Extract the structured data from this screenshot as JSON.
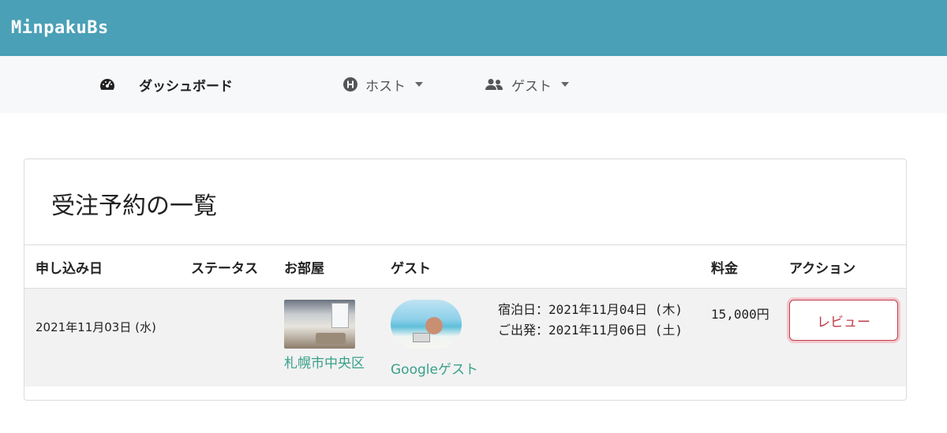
{
  "app": {
    "brand": "MinpakuBs"
  },
  "nav": {
    "dashboard": {
      "label": "ダッシュボード",
      "icon": "gauge-icon"
    },
    "host": {
      "label": "ホスト",
      "icon": "h-circle-icon"
    },
    "guest": {
      "label": "ゲスト",
      "icon": "users-icon"
    }
  },
  "page": {
    "title": "受注予約の一覧"
  },
  "table": {
    "headers": {
      "date": "申し込み日",
      "status": "ステータス",
      "room": "お部屋",
      "guest": "ゲスト",
      "price": "料金",
      "action": "アクション"
    },
    "rows": [
      {
        "date": "2021年11月03日 (水)",
        "status": "",
        "room_name": "札幌市中央区",
        "guest_name": "Googleゲスト",
        "checkin": "宿泊日：2021年11月04日 (木)",
        "checkout": "ご出発：2021年11月06日 (土)",
        "price": "15,000円",
        "action_label": "レビュー"
      }
    ]
  },
  "colors": {
    "topbar": "#4aa0b6",
    "link": "#3aa08b",
    "danger": "#c03d4a"
  }
}
